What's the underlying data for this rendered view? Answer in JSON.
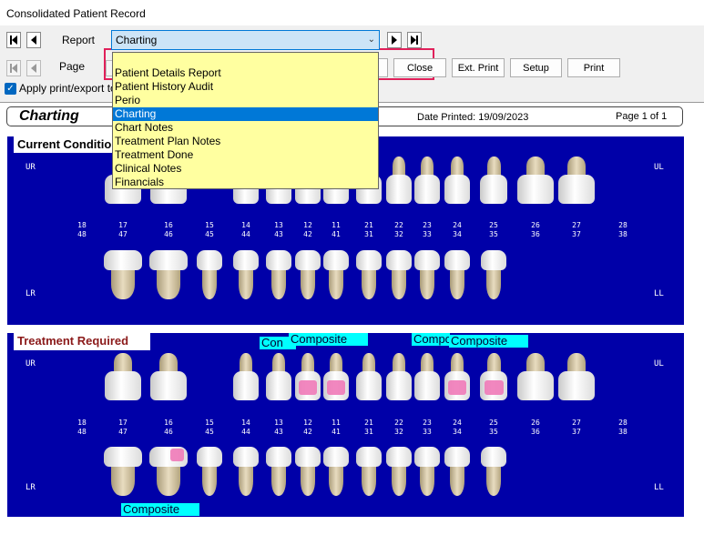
{
  "window": {
    "title": "Consolidated Patient Record"
  },
  "toolbar": {
    "report_label": "Report",
    "page_label": "Page",
    "report_value": "Charting",
    "close_label": "Close",
    "ext_print_label": "Ext. Print",
    "setup_label": "Setup",
    "print_label": "Print",
    "apply_label": "Apply print/export to"
  },
  "dropdown": {
    "items": [
      "",
      "Patient Details Report",
      "Patient History Audit",
      "Perio",
      "Charting",
      "Chart Notes",
      "Treatment Plan Notes",
      "Treatment Done",
      "Clinical Notes",
      "Financials"
    ],
    "selected": "Charting"
  },
  "report": {
    "title": "Charting",
    "patient_initial": "C",
    "date_printed": "Date Printed: 19/09/2023",
    "page": "Page 1 of 1"
  },
  "current": {
    "label": "Current Condition",
    "quadrants": {
      "ur": "UR",
      "ul": "UL",
      "lr": "LR",
      "ll": "LL"
    }
  },
  "treatment": {
    "label": "Treatment Required",
    "quadrants": {
      "ur": "UR",
      "ul": "UL",
      "lr": "LR",
      "ll": "LL"
    },
    "tags": [
      "Con",
      "Composite",
      "Compo",
      "Composite",
      "Composite"
    ]
  },
  "teeth": {
    "upper": [
      "18",
      "17",
      "16",
      "15",
      "14",
      "13",
      "12",
      "11",
      "21",
      "22",
      "23",
      "24",
      "25",
      "26",
      "27",
      "28"
    ],
    "lower": [
      "48",
      "47",
      "46",
      "45",
      "44",
      "43",
      "42",
      "41",
      "31",
      "32",
      "33",
      "34",
      "35",
      "36",
      "37",
      "38"
    ]
  },
  "colors": {
    "panel": "#0000a8",
    "highlight": "#e0205a",
    "tag": "#00ffff",
    "selection": "#0078d7",
    "dropdown": "#ffffa0"
  }
}
